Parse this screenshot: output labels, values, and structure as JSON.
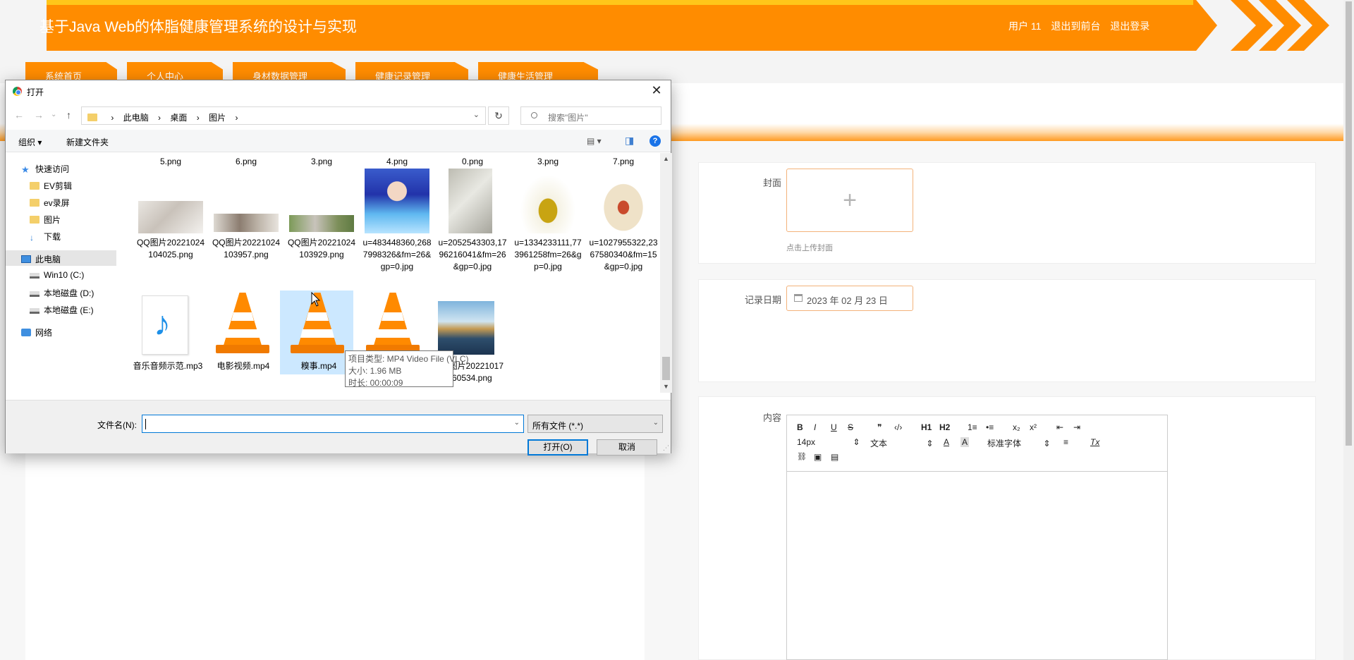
{
  "app": {
    "title": "基于Java Web的体脂健康管理系统的设计与实现",
    "user": "用户 11",
    "to_front": "退出到前台",
    "logout": "退出登录",
    "nav_tabs": [
      "系统首页",
      "个人中心",
      "身材数据管理",
      "健康记录管理",
      "健康生活管理"
    ]
  },
  "form": {
    "cover_label": "封面",
    "cover_plus": "+",
    "cover_hint": "点击上传封面",
    "date_label": "记录日期",
    "date_value": "2023 年 02 月 23 日",
    "content_label": "内容",
    "editor": {
      "bold": "B",
      "italic": "I",
      "underline": "U",
      "strike": "S",
      "quote": "❞",
      "code": "‹/›",
      "h1": "H1",
      "h2": "H2",
      "ol": "1≡",
      "ul": "•≡",
      "sub": "x₂",
      "sup": "x²",
      "indent_less": "⇤",
      "indent_more": "⇥",
      "font_size": "14px",
      "text_type": "文本",
      "font_family": "标准字体",
      "align": "≡",
      "clear": "Tx",
      "link": "🔗",
      "image": "▣",
      "video": "▤"
    }
  },
  "dialog": {
    "title": "打开",
    "close": "✕",
    "back": "←",
    "forward": "→",
    "recent": "⌄",
    "up": "↑",
    "breadcrumb": [
      "此电脑",
      "›",
      "桌面",
      "›",
      "图片",
      "›"
    ],
    "refresh": "↻",
    "search_placeholder": "搜索\"图片\"",
    "organize": "组织 ▾",
    "new_folder": "新建文件夹",
    "view_icon": "▤ ▾",
    "pane_icon": "◨",
    "help": "?",
    "tree": [
      {
        "label": "快速访问",
        "icon": "star-icon"
      },
      {
        "label": "EV剪辑",
        "icon": "folder-icon"
      },
      {
        "label": "ev录屏",
        "icon": "folder-icon"
      },
      {
        "label": "图片",
        "icon": "folder-icon"
      },
      {
        "label": "下载",
        "icon": "download-icon"
      },
      {
        "label": "此电脑",
        "icon": "computer-icon"
      },
      {
        "label": "Win10 (C:)",
        "icon": "drive-icon"
      },
      {
        "label": "本地磁盘 (D:)",
        "icon": "drive-icon"
      },
      {
        "label": "本地磁盘 (E:)",
        "icon": "drive-icon"
      },
      {
        "label": "网络",
        "icon": "network-icon"
      }
    ],
    "top_row": [
      "5.png",
      "6.png",
      "3.png",
      "4.png",
      "0.png",
      "3.png",
      "7.png"
    ],
    "row2": [
      "QQ图片20221024104025.png",
      "QQ图片20221024103957.png",
      "QQ图片20221024103929.png",
      "u=483448360,2687998326&fm=26&gp=0.jpg",
      "u=2052543303,1796216041&fm=26&gp=0.jpg",
      "u=1334233111,773961258fm=26&gp=0.jpg",
      "u=1027955322,2367580340&fm=15&gp=0.jpg"
    ],
    "row3": [
      "音乐音频示范.mp3",
      "电影视频.mp4",
      "糗事.mp4",
      "",
      "QQ图片20221017160534.png"
    ],
    "tooltip": {
      "type": "项目类型: MP4 Video File (VLC)",
      "size": "大小: 1.96 MB",
      "duration": "时长: 00:00:09"
    },
    "filename_label": "文件名(N):",
    "filename_value": "",
    "filetype": "所有文件 (*.*)",
    "open_btn": "打开(O)",
    "cancel_btn": "取消"
  }
}
